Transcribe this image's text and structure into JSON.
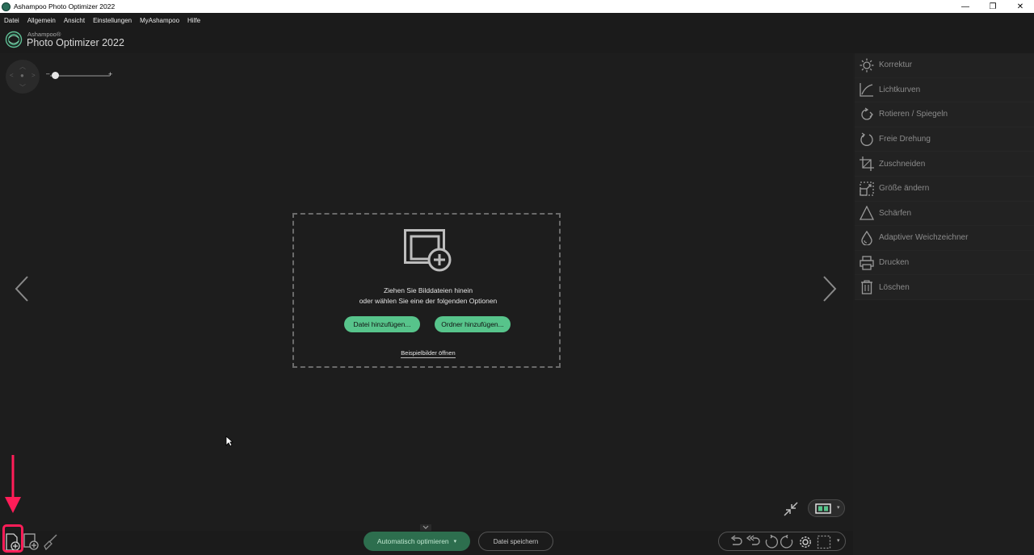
{
  "window": {
    "title": "Ashampoo Photo Optimizer 2022",
    "minimize": "—",
    "maximize": "❐",
    "close": "✕"
  },
  "menu": [
    "Datei",
    "Allgemein",
    "Ansicht",
    "Einstellungen",
    "MyAshampoo",
    "Hilfe"
  ],
  "brand": {
    "sub": "Ashampoo®",
    "name": "Photo Optimizer 2022"
  },
  "zoom": {
    "minus": "–",
    "plus": "+",
    "level": 0.1
  },
  "dropzone": {
    "line1": "Ziehen Sie Bilddateien hinein",
    "line2": "oder wählen Sie eine der folgenden Optionen",
    "add_file": "Datei hinzufügen...",
    "add_folder": "Ordner hinzufügen...",
    "samples": "Beispielbilder öffnen"
  },
  "panel": [
    {
      "label": "Korrektur",
      "icon": "sun-icon"
    },
    {
      "label": "Lichtkurven",
      "icon": "curve-icon"
    },
    {
      "label": "Rotieren / Spiegeln",
      "icon": "rotate-icon"
    },
    {
      "label": "Freie Drehung",
      "icon": "free-rotate-icon"
    },
    {
      "label": "Zuschneiden",
      "icon": "crop-icon"
    },
    {
      "label": "Größe ändern",
      "icon": "resize-icon"
    },
    {
      "label": "Schärfen",
      "icon": "sharpen-icon"
    },
    {
      "label": "Adaptiver Weichzeichner",
      "icon": "drop-icon"
    },
    {
      "label": "Drucken",
      "icon": "printer-icon"
    },
    {
      "label": "Löschen",
      "icon": "trash-icon"
    }
  ],
  "bottom": {
    "auto_optimize": "Automatisch optimieren",
    "save_file": "Datei speichern"
  },
  "colors": {
    "accent": "#57c48b",
    "highlight": "#ff1d58",
    "background": "#1b1b1b"
  }
}
